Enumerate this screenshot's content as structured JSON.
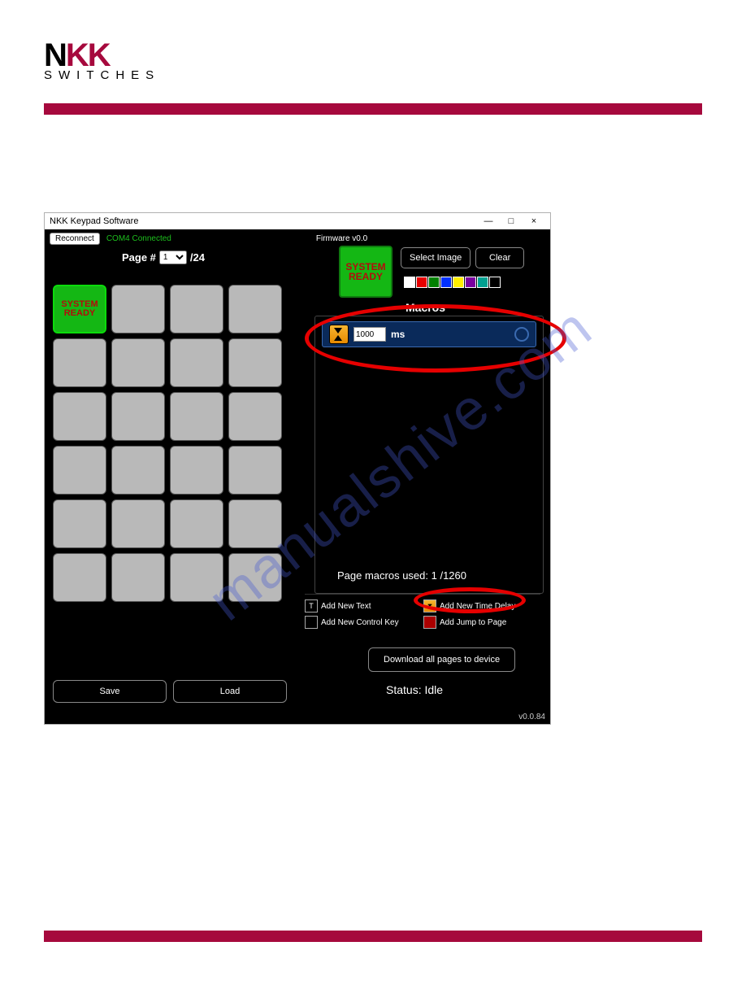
{
  "brand": {
    "main_left": "N",
    "main_mid": "KK",
    "sub": "SWITCHES"
  },
  "window": {
    "title": "NKK Keypad Software",
    "minimize": "—",
    "maximize": "□",
    "close": "×",
    "reconnect": "Reconnect",
    "conn_status": "COM4 Connected",
    "firmware": "Firmware v0.0"
  },
  "page_selector": {
    "label_pre": "Page #",
    "value": "1",
    "total": "/24"
  },
  "preview": {
    "line1": "SYSTEM",
    "line2": "READY"
  },
  "buttons": {
    "select_image": "Select Image",
    "clear": "Clear",
    "download": "Download all pages to device",
    "save": "Save",
    "load": "Load"
  },
  "swatches": [
    "#ffffff",
    "#e60000",
    "#008000",
    "#0030ff",
    "#ffee00",
    "#7a00a0",
    "#00a090",
    "#000000"
  ],
  "macros": {
    "title": "Macros",
    "delay_value": "1000",
    "unit": "ms",
    "used": "Page macros used: 1 /1260",
    "actions": {
      "add_text": "Add New Text",
      "add_control": "Add New Control Key",
      "add_delay": "Add New Time Delay",
      "add_jump": "Add Jump to Page"
    }
  },
  "status": {
    "label": "Status: ",
    "value": "Idle"
  },
  "version": "v0.0.84",
  "watermark": "manualshive.com"
}
